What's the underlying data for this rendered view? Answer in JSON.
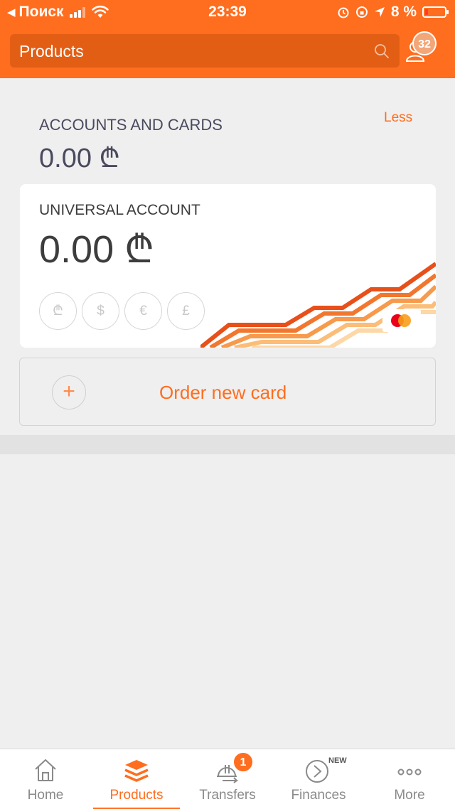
{
  "status_bar": {
    "carrier": "Поиск",
    "time": "23:39",
    "battery": "8 %"
  },
  "header": {
    "title": "Products",
    "notifications_count": "32"
  },
  "summary": {
    "title": "ACCOUNTS AND CARDS",
    "amount": "0.00 ₾",
    "less_label": "Less"
  },
  "account": {
    "title": "UNIVERSAL ACCOUNT",
    "amount": "0.00 ₾",
    "currencies": [
      "₾",
      "$",
      "€",
      "£"
    ]
  },
  "order_card": {
    "label": "Order new card"
  },
  "nav": {
    "items": [
      {
        "label": "Home",
        "icon": "home-icon"
      },
      {
        "label": "Products",
        "icon": "layers-icon"
      },
      {
        "label": "Transfers",
        "icon": "transfer-icon",
        "badge": "1"
      },
      {
        "label": "Finances",
        "icon": "finance-icon",
        "tag": "NEW"
      },
      {
        "label": "More",
        "icon": "more-icon"
      }
    ],
    "active": "Products"
  },
  "colors": {
    "accent": "#ff6d1e",
    "background": "#efefef"
  }
}
